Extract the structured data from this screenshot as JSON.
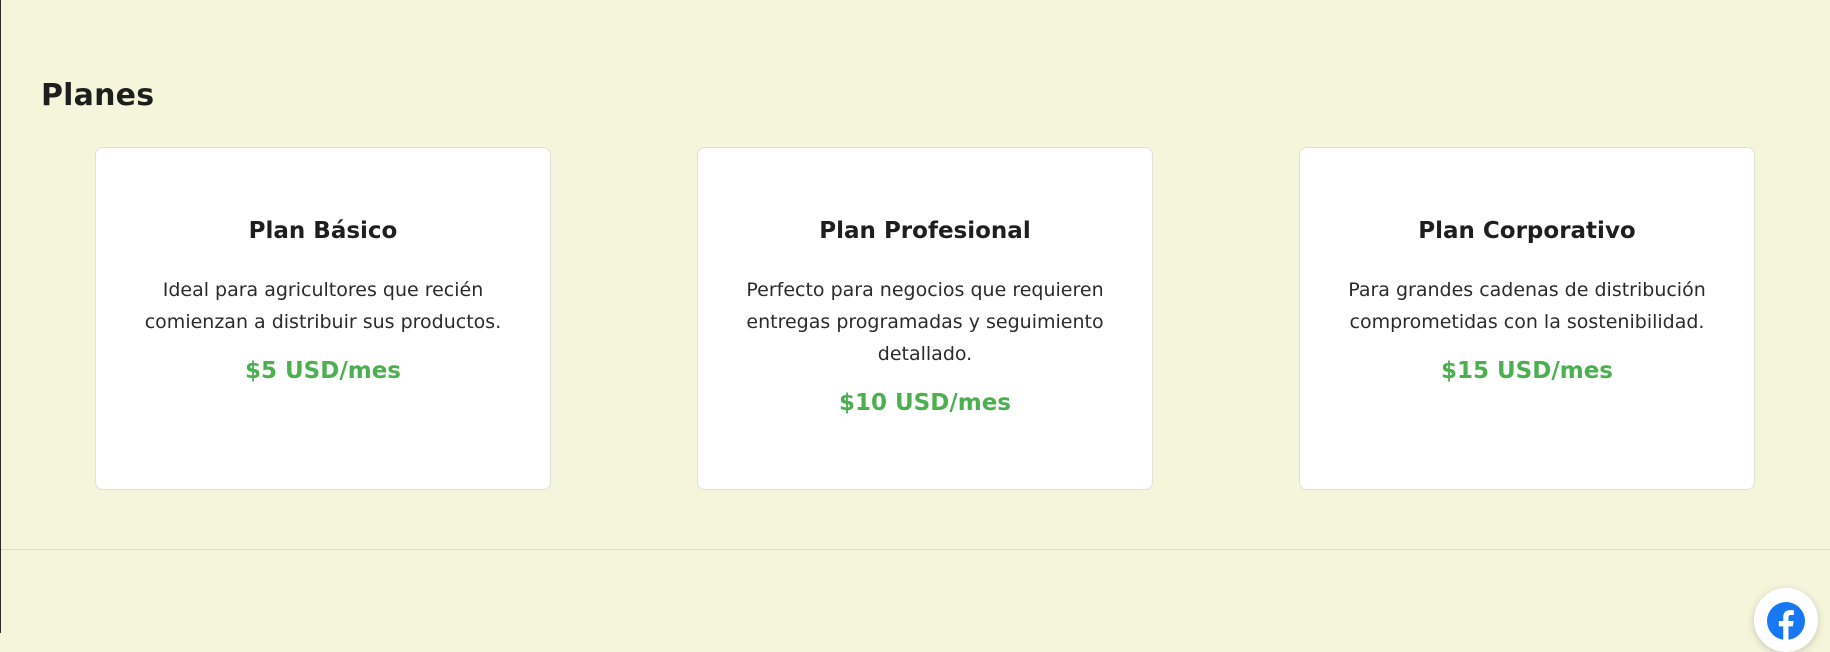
{
  "plans_section": {
    "title": "Planes",
    "plans": [
      {
        "name": "Plan Básico",
        "description": "Ideal para agricultores que recién comienzan a distribuir sus productos.",
        "price": "$5 USD/mes"
      },
      {
        "name": "Plan Profesional",
        "description": "Perfecto para negocios que requieren entregas programadas y seguimiento detallado.",
        "price": "$10 USD/mes"
      },
      {
        "name": "Plan Corporativo",
        "description": "Para grandes cadenas de distribución comprometidas con la sostenibilidad.",
        "price": "$15 USD/mes"
      }
    ]
  },
  "social": {
    "facebook_icon": "facebook-icon"
  },
  "colors": {
    "page_background": "#f5f5dc",
    "card_background": "#ffffff",
    "price_accent": "#4caf50",
    "facebook_blue": "#1877f2"
  }
}
